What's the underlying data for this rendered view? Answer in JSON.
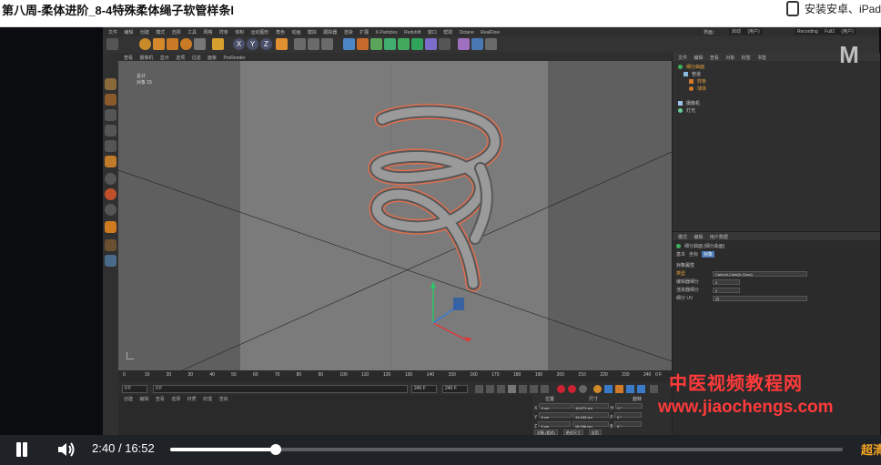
{
  "window": {
    "title": "第八周-柔体进阶_8-4特殊柔体绳子软管样条l",
    "install_text": "安装安卓、iPad"
  },
  "c4d": {
    "menu": [
      "文件",
      "编辑",
      "创建",
      "模式",
      "选择",
      "工具",
      "网格",
      "样条",
      "体积",
      "运动图形",
      "角色",
      "动画",
      "模拟",
      "跟踪器",
      "渲染",
      "扩展",
      "X-Particles",
      "Redshift",
      "窗口",
      "帮助",
      "Octane",
      "RealFlow"
    ],
    "layout_label": "界面：",
    "layout_value": "启动 (用户)",
    "recording_value": "Recording Full2 (用户)",
    "viewport_menu": [
      "查看",
      "摄像机",
      "显示",
      "选项",
      "过滤",
      "面板",
      "ProRender"
    ],
    "viewport_info_line1": "总计",
    "viewport_info_line2": "对象  15",
    "timeline_ticks": [
      "0",
      "10",
      "20",
      "30",
      "40",
      "50",
      "60",
      "70",
      "80",
      "90",
      "100",
      "110",
      "120",
      "130",
      "140",
      "150",
      "160",
      "170",
      "180",
      "190",
      "200",
      "210",
      "220",
      "230",
      "240"
    ],
    "timeline_end": "0 F",
    "transport": {
      "start": "0 F",
      "mid": "0 F",
      "end_a": "240 F",
      "end_b": "240 F"
    },
    "bottom_tabs": [
      "创建",
      "编辑",
      "查看",
      "选择",
      "材质",
      "纹理",
      "渲染"
    ],
    "coords": {
      "header": [
        "位置",
        "尺寸",
        "旋转"
      ],
      "rows": [
        {
          "axis": "X",
          "pos": "0 cm",
          "size": "16.071 cm",
          "rot_axis": "H",
          "rot": "0 °"
        },
        {
          "axis": "Y",
          "pos": "0 cm",
          "size": "19.153 cm",
          "rot_axis": "P",
          "rot": "0 °"
        },
        {
          "axis": "Z",
          "pos": "0 cm",
          "size": "16.766 cm",
          "rot_axis": "B",
          "rot": "0 °"
        }
      ],
      "buttons": [
        "对象 (相对)",
        "绝对尺寸",
        "应用"
      ]
    },
    "object_manager": {
      "tabs": [
        "文件",
        "编辑",
        "查看",
        "对象",
        "标签",
        "书签"
      ],
      "items": [
        "细分曲面",
        "管道",
        "样条",
        "球体",
        "摄像机",
        "灯光"
      ]
    },
    "attribute_manager": {
      "tabs": [
        "模式",
        "编辑",
        "用户数据"
      ],
      "object_title": "细分曲面 [细分曲面]",
      "sub_tabs": [
        "基本",
        "坐标",
        "对象"
      ],
      "section": "对象属性",
      "rows": [
        {
          "label": "类型",
          "value": "Catmull-Clark(N-Gons)"
        },
        {
          "label": "编辑器细分",
          "value": "2"
        },
        {
          "label": "渲染器细分",
          "value": "2"
        },
        {
          "label": "细分 UV",
          "value": "边"
        }
      ]
    }
  },
  "watermark": {
    "line1": "中医视频教程网",
    "line2": "www.jiaochengs.com",
    "logo": "M"
  },
  "player": {
    "current_time": "2:40",
    "separator": "/",
    "total_time": "16:52",
    "progress": 0.157,
    "quality_label": "超清",
    "icons": {
      "play_state": "pause-icon",
      "volume": "volume-icon"
    }
  },
  "colors": {
    "accent": "#ff3a3a",
    "quality": "#f5a623"
  }
}
